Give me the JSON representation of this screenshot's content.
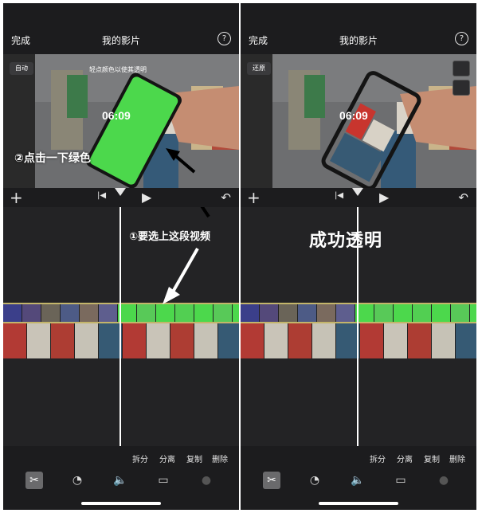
{
  "left": {
    "top_bar": {
      "done_label": "完成",
      "title": "我的影片",
      "help_label": "?"
    },
    "preview": {
      "mode_button": "自动",
      "hint": "轻点颜色以使其透明",
      "phone_time": "06:09",
      "annotation": "②点击一下绿色"
    },
    "timeline": {
      "annotation": "①要选上这段视频"
    },
    "actions": [
      "拆分",
      "分离",
      "复制",
      "删除"
    ]
  },
  "right": {
    "top_bar": {
      "done_label": "完成",
      "title": "我的影片",
      "help_label": "?"
    },
    "preview": {
      "mode_button": "还原",
      "phone_time": "06:09"
    },
    "timeline": {
      "annotation": "成功透明"
    },
    "actions": [
      "拆分",
      "分离",
      "复制",
      "删除"
    ]
  },
  "icons": {
    "add": "plus-icon",
    "skip_back": "skip-to-start-icon",
    "play": "play-icon",
    "undo": "undo-icon",
    "scissors": "scissors-icon",
    "speed": "speedometer-icon",
    "volume": "volume-icon",
    "split_screen": "title-layout-icon",
    "filter": "filter-icon"
  },
  "colors": {
    "chroma_green": "#4cd84c",
    "clip_border": "#c3b56a",
    "background": "#1c1c1e"
  }
}
